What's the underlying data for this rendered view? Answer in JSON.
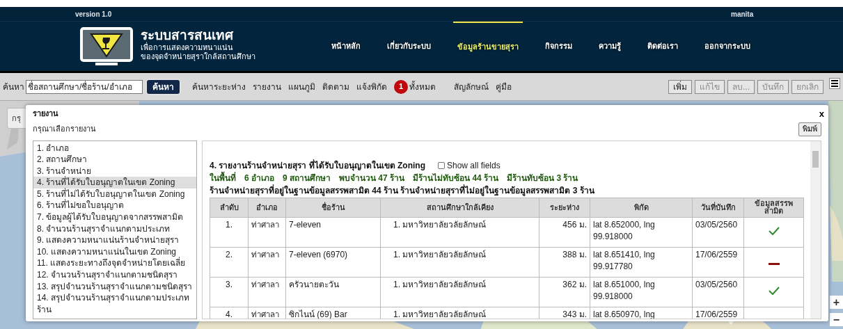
{
  "version": "version 1.0",
  "user": "manita",
  "logo": {
    "title": "ระบบสารสนเทศ",
    "subtitle_1": "เพื่อการแสดงความหนาแน่น",
    "subtitle_2": "ของจุดจำหน่ายสุราใกล้สถานศึกษา"
  },
  "nav": [
    {
      "label": "หน้าหลัก",
      "selected": false
    },
    {
      "label": "เกี่ยวกับระบบ",
      "selected": false
    },
    {
      "label": "ข้อมูลร้านขายสุรา",
      "selected": true
    },
    {
      "label": "กิจกรรม",
      "selected": false
    },
    {
      "label": "ความรู้",
      "selected": false
    },
    {
      "label": "ติดต่อเรา",
      "selected": false
    },
    {
      "label": "ออกจากระบบ",
      "selected": false
    }
  ],
  "toolbar": {
    "search_label": "ค้นหา",
    "search_value": "ชื่อสถานศึกษา/ชื่อร้าน/อำเภอ",
    "search_button": "ค้นหา",
    "links": [
      "ค้นหาระยะห่าง",
      "รายงาน",
      "แผนภูมิ",
      "ติดตาม",
      "แจ้งพิกัด"
    ],
    "badge": "1",
    "badge_label": "ทั้งหมด",
    "links_2": [
      "สัญลักษณ์",
      "คู่มือ"
    ],
    "buttons": [
      {
        "label": "เพิ่ม",
        "disabled": false
      },
      {
        "label": "แก้ไข",
        "disabled": true
      },
      {
        "label": "ลบ...",
        "disabled": true
      },
      {
        "label": "บันทึก",
        "disabled": true
      },
      {
        "label": "ยกเลิก",
        "disabled": true
      }
    ]
  },
  "side_button": "กรุ",
  "map_controls": [
    "+",
    "−"
  ],
  "dialog": {
    "title": "รายงาน",
    "close": "x",
    "prompt": "กรุณาเลือกรายงาน",
    "print": "พิมพ์",
    "reports": [
      {
        "label": "1. อำเภอ",
        "selected": false
      },
      {
        "label": "2. สถานศึกษา",
        "selected": false
      },
      {
        "label": "3. ร้านจำหน่าย",
        "selected": false
      },
      {
        "label": "4. ร้านที่ได้รับใบอนุญาตในเขต Zoning",
        "selected": true
      },
      {
        "label": "5. ร้านที่ไม่ได้รับใบอนุญาตในเขต Zoning",
        "selected": false
      },
      {
        "label": "6. ร้านที่ไม่ขอใบอนุญาต",
        "selected": false
      },
      {
        "label": "7. ข้อมูลผู้ได้รับใบอนุญาตจากสรรพสามิต",
        "selected": false
      },
      {
        "label": "8. จำนวนร้านสุราจำแนกตามประเภท",
        "selected": false
      },
      {
        "label": "9. แสดงความหนาแน่นร้านจำหน่ายสุรา",
        "selected": false
      },
      {
        "label": "10. แสดงความหนาแน่นในเขต Zoning",
        "selected": false
      },
      {
        "label": "11. แสดงระยะทางถึงจุดจำหน่ายโดยเฉลี่ย",
        "selected": false
      },
      {
        "label": "12. จำนวนร้านสุราจำแนกตามชนิดสุรา",
        "selected": false
      },
      {
        "label": "13. สรุปจำนวนร้านสุราจำแนกตามชนิดสุรา",
        "selected": false
      },
      {
        "label": "14. สรุปจำนวนร้านสุราจำแนกตามประเภทร้าน",
        "selected": false
      }
    ],
    "report": {
      "heading": "4. รายงานร้านจำหน่ายสุรา ที่ได้รับใบอนุญาตในเขต Zoning",
      "show_all": {
        "label": "Show all fields",
        "checked": false
      },
      "summary_1": [
        "ในพื้นที่",
        "6 อำเภอ",
        "9 สถานศึกษา",
        "พบจำนวน 47 ร้าน",
        "มีร้านไม่ทับซ้อน 44 ร้าน",
        "มีร้านทับซ้อน 3 ร้าน"
      ],
      "summary_2": "ร้านจำหน่ายสุราที่อยู่ในฐานข้อมูลสรรพสามิต 44 ร้าน ร้านจำหน่ายสุราที่ไม่อยู่ในฐานข้อมูลสรรพสามิต 3 ร้าน",
      "columns": [
        "ลำดับ",
        "อำเภอ",
        "ชื่อร้าน",
        "สถานศึกษาใกล้เคียง",
        "ระยะห่าง",
        "พิกัด",
        "วันที่บันทึก",
        "ข้อมูลสรรพสามิต"
      ],
      "rows": [
        {
          "no": "1.",
          "district": "ท่าศาลา",
          "shop": "7-eleven",
          "school": "1. มหาวิทยาลัยวลัยลักษณ์",
          "distance": "456 ม.",
          "coord": "lat 8.652000, lng 99.918000",
          "date": "03/05/2560",
          "in_db": true
        },
        {
          "no": "2.",
          "district": "ท่าศาลา",
          "shop": "7-eleven (6970)",
          "school": "1. มหาวิทยาลัยวลัยลักษณ์",
          "distance": "388 ม.",
          "coord": "lat 8.651410, lng 99.917780",
          "date": "17/06/2559",
          "in_db": false
        },
        {
          "no": "3.",
          "district": "ท่าศาลา",
          "shop": "ครัวนายตะวัน",
          "school": "1. มหาวิทยาลัยวลัยลักษณ์",
          "distance": "362 ม.",
          "coord": "lat 8.651000, lng 99.918000",
          "date": "03/05/2560",
          "in_db": true
        },
        {
          "no": "4.",
          "district": "ท่าศาลา",
          "shop": "ซิกไนน์ (69) Bar",
          "school": "1. มหาวิทยาลัยวลัยลักษณ์",
          "distance": "343 ม.",
          "coord": "lat 8.650970, lng",
          "date": "17/06/2559"
        }
      ]
    }
  }
}
